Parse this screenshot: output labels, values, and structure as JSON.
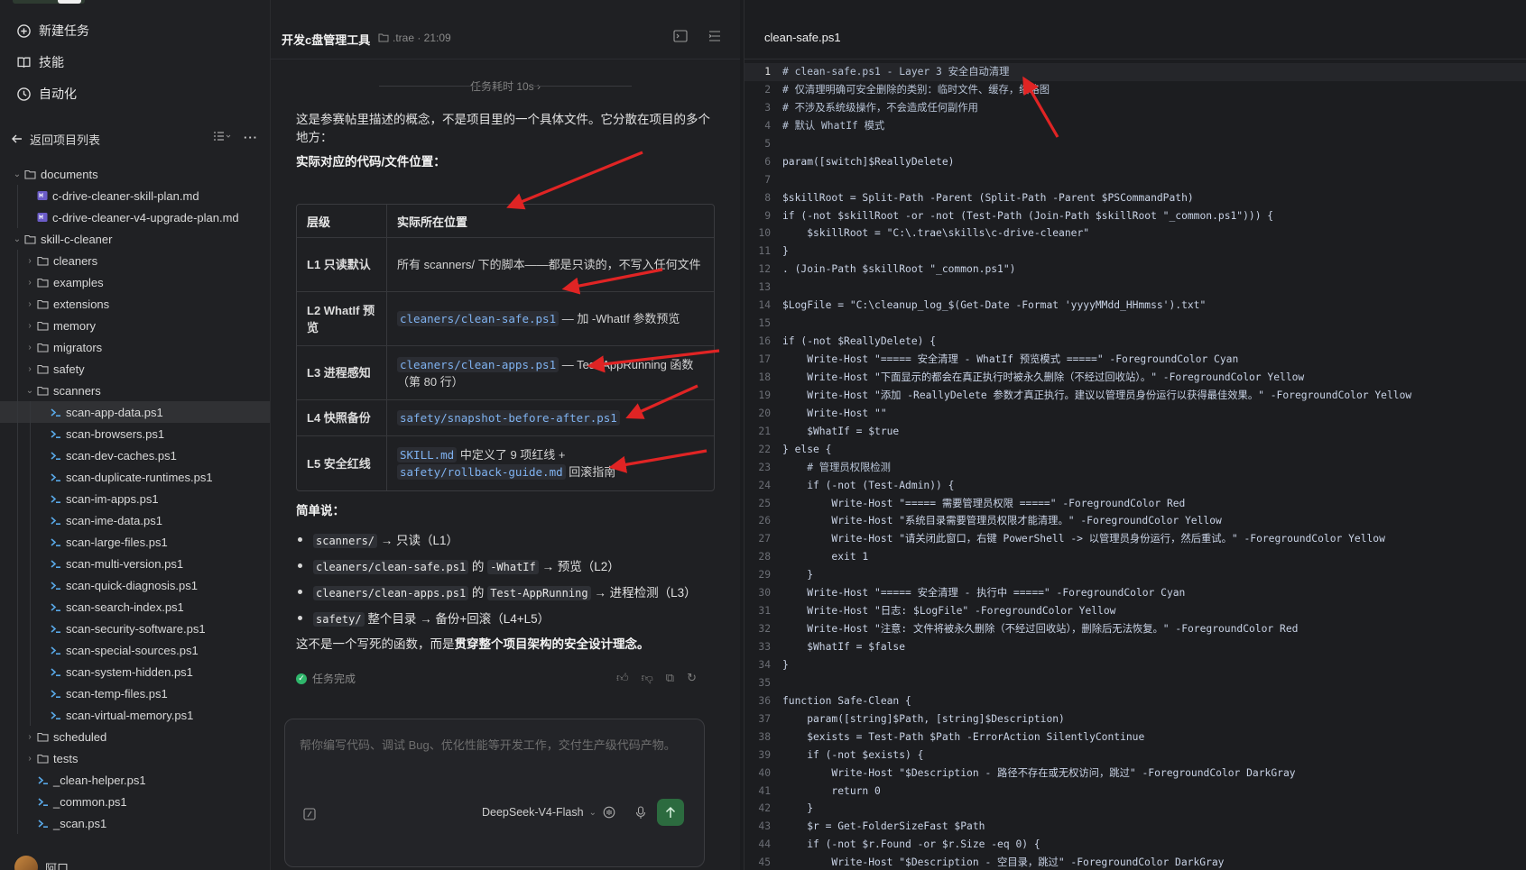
{
  "sidebar": {
    "nav": [
      {
        "label": "新建任务",
        "icon": "new-task-icon"
      },
      {
        "label": "技能",
        "icon": "book-icon"
      },
      {
        "label": "自动化",
        "icon": "clock-icon"
      }
    ],
    "back_label": "返回项目列表",
    "tree": [
      {
        "name": "documents",
        "type": "folder",
        "depth": 0,
        "open": true
      },
      {
        "name": "c-drive-cleaner-skill-plan.md",
        "type": "md",
        "depth": 1
      },
      {
        "name": "c-drive-cleaner-v4-upgrade-plan.md",
        "type": "md",
        "depth": 1
      },
      {
        "name": "skill-c-cleaner",
        "type": "folder",
        "depth": 0,
        "open": true
      },
      {
        "name": "cleaners",
        "type": "folder",
        "depth": 1
      },
      {
        "name": "examples",
        "type": "folder",
        "depth": 1
      },
      {
        "name": "extensions",
        "type": "folder",
        "depth": 1
      },
      {
        "name": "memory",
        "type": "folder",
        "depth": 1
      },
      {
        "name": "migrators",
        "type": "folder",
        "depth": 1
      },
      {
        "name": "safety",
        "type": "folder",
        "depth": 1
      },
      {
        "name": "scanners",
        "type": "folder",
        "depth": 1,
        "open": true
      },
      {
        "name": "scan-app-data.ps1",
        "type": "ps1",
        "depth": 2,
        "active": true
      },
      {
        "name": "scan-browsers.ps1",
        "type": "ps1",
        "depth": 2
      },
      {
        "name": "scan-dev-caches.ps1",
        "type": "ps1",
        "depth": 2
      },
      {
        "name": "scan-duplicate-runtimes.ps1",
        "type": "ps1",
        "depth": 2
      },
      {
        "name": "scan-im-apps.ps1",
        "type": "ps1",
        "depth": 2
      },
      {
        "name": "scan-ime-data.ps1",
        "type": "ps1",
        "depth": 2
      },
      {
        "name": "scan-large-files.ps1",
        "type": "ps1",
        "depth": 2
      },
      {
        "name": "scan-multi-version.ps1",
        "type": "ps1",
        "depth": 2
      },
      {
        "name": "scan-quick-diagnosis.ps1",
        "type": "ps1",
        "depth": 2
      },
      {
        "name": "scan-search-index.ps1",
        "type": "ps1",
        "depth": 2
      },
      {
        "name": "scan-security-software.ps1",
        "type": "ps1",
        "depth": 2
      },
      {
        "name": "scan-special-sources.ps1",
        "type": "ps1",
        "depth": 2
      },
      {
        "name": "scan-system-hidden.ps1",
        "type": "ps1",
        "depth": 2
      },
      {
        "name": "scan-temp-files.ps1",
        "type": "ps1",
        "depth": 2
      },
      {
        "name": "scan-virtual-memory.ps1",
        "type": "ps1",
        "depth": 2
      },
      {
        "name": "scheduled",
        "type": "folder",
        "depth": 1
      },
      {
        "name": "tests",
        "type": "folder",
        "depth": 1
      },
      {
        "name": "_clean-helper.ps1",
        "type": "ps1",
        "depth": 1
      },
      {
        "name": "_common.ps1",
        "type": "ps1",
        "depth": 1
      },
      {
        "name": "_scan.ps1",
        "type": "ps1",
        "depth": 1
      }
    ],
    "user_name": "阿口"
  },
  "chat": {
    "title": "开发c盘管理工具",
    "meta": ".trae · 21:09",
    "duration": "任务耗时 10s ›",
    "intro": "这是参赛帖里描述的概念，不是项目里的一个具体文件。它分散在项目的多个地方：",
    "subhead": "实际对应的代码/文件位置：",
    "table": {
      "headers": [
        "层级",
        "实际所在位置"
      ],
      "rows": [
        {
          "level": "L1 只读默认",
          "pre": "所有 scanners/ 下的脚本——都是只读的，不写入任何文件",
          "code": "",
          "post": ""
        },
        {
          "level": "L2 WhatIf 预览",
          "code": "cleaners/clean-safe.ps1",
          "post": " — 加 -WhatIf 参数预览"
        },
        {
          "level": "L3 进程感知",
          "code": "cleaners/clean-apps.ps1",
          "post": " — Test-AppRunning 函数（第 80 行）"
        },
        {
          "level": "L4 快照备份",
          "code": "safety/snapshot-before-after.ps1",
          "post": ""
        },
        {
          "level": "L5 安全红线",
          "code": "SKILL.md",
          "mid": " 中定义了 9 项红线 + ",
          "code2": "safety/rollback-guide.md",
          "post": " 回滚指南"
        }
      ]
    },
    "summary_head": "简单说：",
    "bullets": [
      {
        "c1": "scanners/",
        "t1": " → 只读（L1）"
      },
      {
        "c1": "cleaners/clean-safe.ps1",
        "t1": " 的 ",
        "c2": "-WhatIf",
        "t2": " → 预览（L2）"
      },
      {
        "c1": "cleaners/clean-apps.ps1",
        "t1": " 的 ",
        "c2": "Test-AppRunning",
        "t2": " → 进程检测（L3）"
      },
      {
        "c1": "safety/",
        "t1": " 整个目录 → 备份+回滚（L4+L5）"
      }
    ],
    "conclusion_a": "这不是一个写死的函数，而是",
    "conclusion_b": "贯穿整个项目架构的安全设计理念。",
    "done_label": "任务完成",
    "input_placeholder": "帮你编写代码、调试 Bug、优化性能等开发工作，交付生产级代码产物。",
    "model": "DeepSeek-V4-Flash"
  },
  "editor": {
    "filename": "clean-safe.ps1",
    "current_line": 1,
    "lines": [
      "# clean-safe.ps1 - Layer 3 安全自动清理",
      "# 仅清理明确可安全删除的类别：临时文件、缓存，缩略图",
      "# 不涉及系统级操作，不会造成任何副作用",
      "# 默认 WhatIf 模式",
      "",
      "param([switch]$ReallyDelete)",
      "",
      "$skillRoot = Split-Path -Parent (Split-Path -Parent $PSCommandPath)",
      "if (-not $skillRoot -or -not (Test-Path (Join-Path $skillRoot \"_common.ps1\"))) {",
      "    $skillRoot = \"C:\\.trae\\skills\\c-drive-cleaner\"",
      "}",
      ". (Join-Path $skillRoot \"_common.ps1\")",
      "",
      "$LogFile = \"C:\\cleanup_log_$(Get-Date -Format 'yyyyMMdd_HHmmss').txt\"",
      "",
      "if (-not $ReallyDelete) {",
      "    Write-Host \"===== 安全清理 - WhatIf 预览模式 =====\" -ForegroundColor Cyan",
      "    Write-Host \"下面显示的都会在真正执行时被永久删除（不经过回收站）。\" -ForegroundColor Yellow",
      "    Write-Host \"添加 -ReallyDelete 参数才真正执行。建议以管理员身份运行以获得最佳效果。\" -ForegroundColor Yellow",
      "    Write-Host \"\"",
      "    $WhatIf = $true",
      "} else {",
      "    # 管理员权限检测",
      "    if (-not (Test-Admin)) {",
      "        Write-Host \"===== 需要管理员权限 =====\" -ForegroundColor Red",
      "        Write-Host \"系统目录需要管理员权限才能清理。\" -ForegroundColor Yellow",
      "        Write-Host \"请关闭此窗口，右键 PowerShell -> 以管理员身份运行，然后重试。\" -ForegroundColor Yellow",
      "        exit 1",
      "    }",
      "    Write-Host \"===== 安全清理 - 执行中 =====\" -ForegroundColor Cyan",
      "    Write-Host \"日志: $LogFile\" -ForegroundColor Yellow",
      "    Write-Host \"注意: 文件将被永久删除（不经过回收站），删除后无法恢复。\" -ForegroundColor Red",
      "    $WhatIf = $false",
      "}",
      "",
      "function Safe-Clean {",
      "    param([string]$Path, [string]$Description)",
      "    $exists = Test-Path $Path -ErrorAction SilentlyContinue",
      "    if (-not $exists) {",
      "        Write-Host \"$Description - 路径不存在或无权访问，跳过\" -ForegroundColor DarkGray",
      "        return 0",
      "    }",
      "    $r = Get-FolderSizeFast $Path",
      "    if (-not $r.Found -or $r.Size -eq 0) {",
      "        Write-Host \"$Description - 空目录，跳过\" -ForegroundColor DarkGray"
    ]
  },
  "colors": {
    "accent_green": "#2fb66b",
    "arrow_red": "#e02424",
    "code_link": "#7fb2f0"
  }
}
